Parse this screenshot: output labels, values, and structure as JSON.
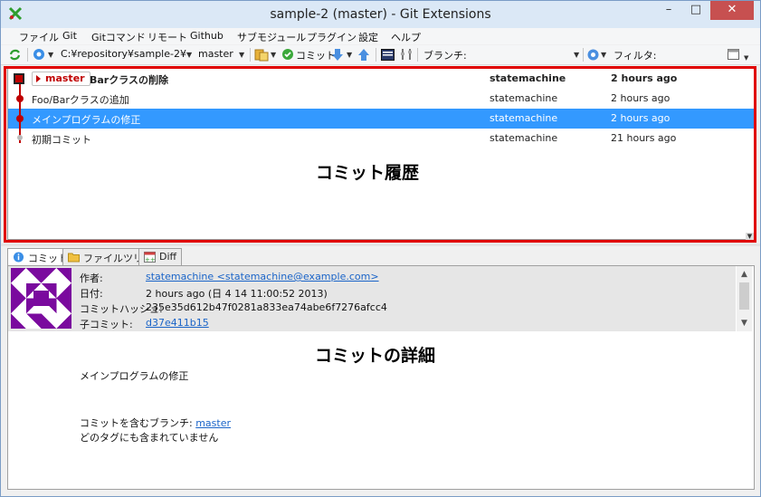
{
  "window": {
    "title": "sample-2 (master) - Git Extensions",
    "minimize": "–",
    "maximize": "□",
    "close": "✕"
  },
  "menu": [
    "ファイル",
    "Git",
    "Gitコマンド",
    "リモート",
    "Github",
    "サブモジュール",
    "プラグイン",
    "設定",
    "ヘルプ"
  ],
  "toolbar": {
    "path": "C:¥repository¥sample-2¥",
    "branch": "master",
    "commit_label": "コミット",
    "branch_filter_label": "ブランチ:",
    "filter_label": "フィルタ:"
  },
  "commits": [
    {
      "message": "Barクラスの削除",
      "author": "statemachine",
      "date": "2 hours ago",
      "branch_label": "master",
      "bold": true
    },
    {
      "message": "Foo/Barクラスの追加",
      "author": "statemachine",
      "date": "2 hours ago"
    },
    {
      "message": "メインプログラムの修正",
      "author": "statemachine",
      "date": "2 hours ago",
      "selected": true
    },
    {
      "message": "初期コミット",
      "author": "statemachine",
      "date": "21 hours ago"
    }
  ],
  "annotations": {
    "history": "コミット履歴",
    "details": "コミットの詳細"
  },
  "tabs": [
    {
      "label": "コミット",
      "icon": "info-icon"
    },
    {
      "label": "ファイルツリー",
      "icon": "folder-icon"
    },
    {
      "label": "Diff",
      "icon": "diff-icon"
    }
  ],
  "details": {
    "author_label": "作者:",
    "author_value": "statemachine <statemachine@example.com>",
    "date_label": "日付:",
    "date_value": "2 hours ago (日 4 14 11:00:52 2013)",
    "hash_label": "コミットハッシュ:",
    "hash_value": "235e35d612b47f0281a833ea74abe6f7276afcc4",
    "child_label": "子コミット:",
    "child_value": "d37e411b15",
    "message": "メインプログラムの修正",
    "contains_branches_label": "コミットを含むブランチ:",
    "contains_branches_value": "master",
    "no_tags_text": "どのタグにも含まれていません"
  },
  "colors": {
    "accent_red": "#e00000",
    "selection": "#3399ff",
    "graph": "#c00000",
    "avatar": "#7a0a9e"
  }
}
